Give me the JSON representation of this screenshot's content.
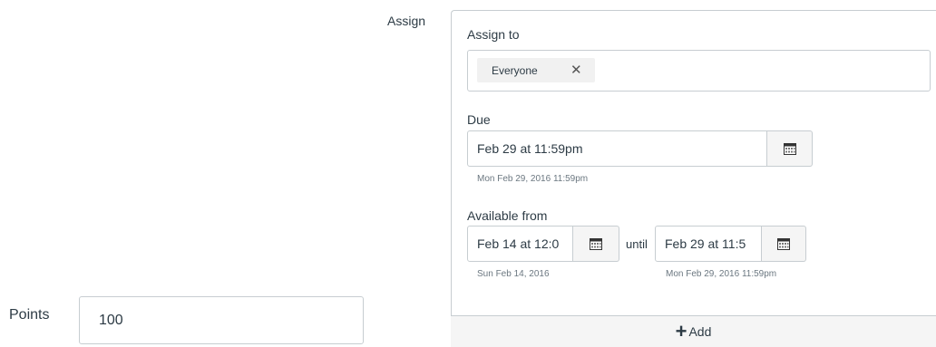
{
  "assign_section": {
    "label": "Assign",
    "assign_to": {
      "label": "Assign to",
      "tokens": [
        {
          "label": "Everyone",
          "remove": "✕"
        }
      ]
    },
    "due": {
      "label": "Due",
      "value": "Feb 29 at 11:59pm",
      "hint": "Mon Feb 29, 2016 11:59pm"
    },
    "available": {
      "label": "Available from",
      "from_value": "Feb 14 at 12:0",
      "from_hint": "Sun Feb 14, 2016",
      "until_label": "until",
      "until_value": "Feb 29 at 11:5",
      "until_hint": "Mon Feb 29, 2016 11:59pm"
    },
    "add_button": {
      "icon": "+",
      "label": "Add"
    }
  },
  "points": {
    "label": "Points",
    "value": "100"
  },
  "icons": {
    "calendar": "calendar-icon",
    "plus": "plus-icon",
    "remove": "close-icon"
  }
}
